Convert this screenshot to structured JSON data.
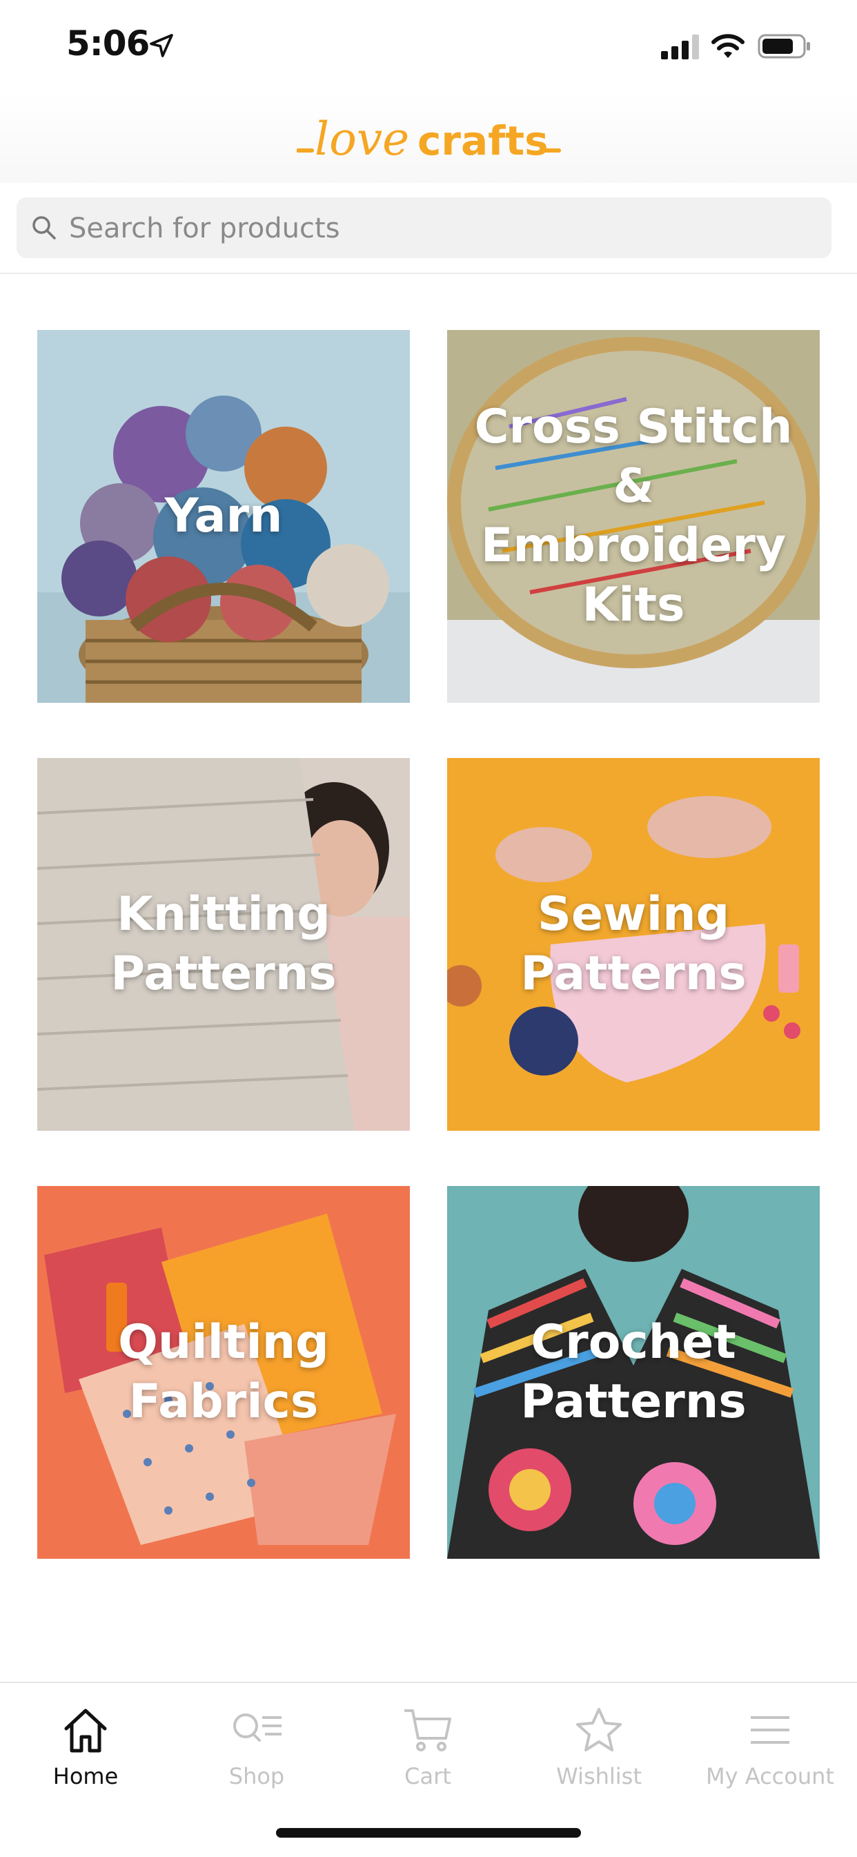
{
  "status_bar": {
    "time": "5:06"
  },
  "brand": {
    "name": "lovecrafts",
    "accent_color": "#f5a623"
  },
  "search": {
    "placeholder": "Search for products",
    "value": ""
  },
  "categories": [
    {
      "label": "Yarn"
    },
    {
      "label": "Cross Stitch & Embroidery Kits"
    },
    {
      "label": "Knitting Patterns"
    },
    {
      "label": "Sewing Patterns"
    },
    {
      "label": "Quilting Fabrics"
    },
    {
      "label": "Crochet Patterns"
    }
  ],
  "tab_bar": {
    "items": [
      {
        "label": "Home",
        "icon": "home-icon",
        "active": true
      },
      {
        "label": "Shop",
        "icon": "shop-icon",
        "active": false
      },
      {
        "label": "Cart",
        "icon": "cart-icon",
        "active": false
      },
      {
        "label": "Wishlist",
        "icon": "star-icon",
        "active": false
      },
      {
        "label": "My Account",
        "icon": "menu-icon",
        "active": false
      }
    ]
  }
}
